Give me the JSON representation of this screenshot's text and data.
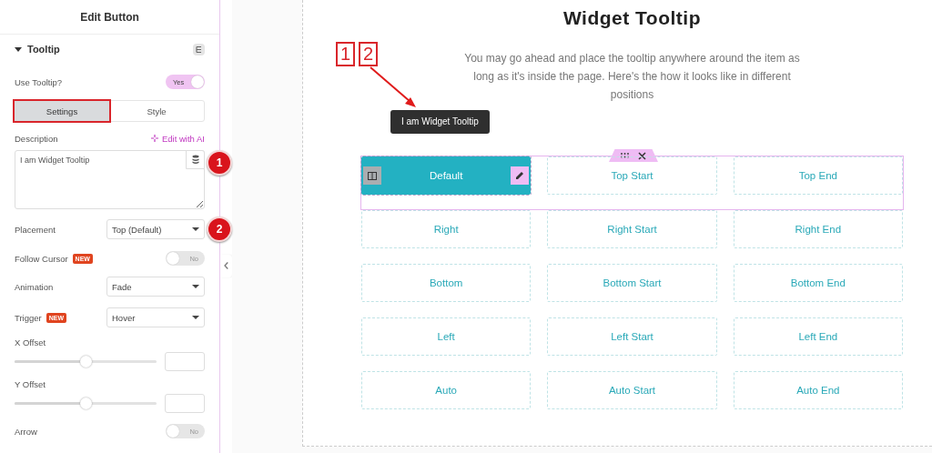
{
  "panel": {
    "title": "Edit Button",
    "section": {
      "title": "Tooltip",
      "expanded": true
    },
    "controls": [
      {
        "kind": "toggle",
        "label": "Use Tooltip?",
        "on": true,
        "text": "Yes"
      },
      {
        "kind": "tabs",
        "tabs": [
          {
            "label": "Settings",
            "selected": true,
            "highlighted": true
          },
          {
            "label": "Style",
            "selected": false,
            "highlighted": false
          }
        ]
      },
      {
        "kind": "textarea",
        "label": "Description",
        "action": "Edit with AI",
        "value": "I am Widget Tooltip",
        "marker": "1"
      },
      {
        "kind": "select",
        "label": "Placement",
        "value": "Top (Default)",
        "marker": "2"
      },
      {
        "kind": "toggle",
        "label": "Follow Cursor",
        "badge": "NEW",
        "on": false,
        "text": "No"
      },
      {
        "kind": "select",
        "label": "Animation",
        "value": "Fade"
      },
      {
        "kind": "select",
        "label": "Trigger",
        "badge": "NEW",
        "value": "Hover"
      },
      {
        "kind": "slider",
        "label": "X Offset",
        "level": 0.5
      },
      {
        "kind": "slider",
        "label": "Y Offset",
        "level": 0.5
      },
      {
        "kind": "toggle",
        "label": "Arrow",
        "on": false,
        "text": "No"
      }
    ]
  },
  "page": {
    "title": "Widget Tooltip",
    "description": "You may go ahead and place the tooltip anywhere around the item as long as it's inside the page. Here's the how it looks like in different positions",
    "tooltip": "I am Widget Tooltip",
    "callout_labels": [
      "1",
      "2"
    ],
    "buttons": [
      [
        {
          "label": "Default",
          "selected": true
        },
        {
          "label": "Top Start",
          "selected": false
        },
        {
          "label": "Top End",
          "selected": false
        }
      ],
      [
        {
          "label": "Right",
          "selected": false
        },
        {
          "label": "Right Start",
          "selected": false
        },
        {
          "label": "Right End",
          "selected": false
        }
      ],
      [
        {
          "label": "Bottom",
          "selected": false
        },
        {
          "label": "Bottom Start",
          "selected": false
        },
        {
          "label": "Bottom End",
          "selected": false
        }
      ],
      [
        {
          "label": "Left",
          "selected": false
        },
        {
          "label": "Left Start",
          "selected": false
        },
        {
          "label": "Left End",
          "selected": false
        }
      ],
      [
        {
          "label": "Auto",
          "selected": false
        },
        {
          "label": "Auto Start",
          "selected": false
        },
        {
          "label": "Auto End",
          "selected": false
        }
      ]
    ]
  }
}
